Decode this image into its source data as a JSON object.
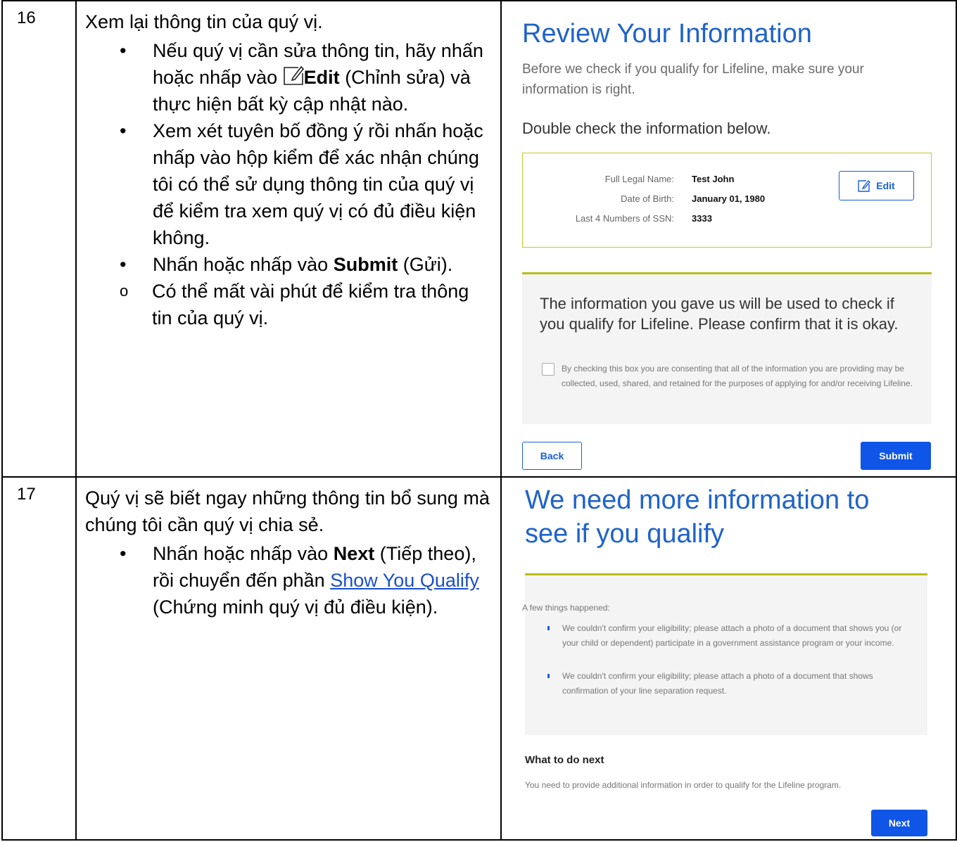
{
  "step16": {
    "number": "16",
    "intro": "Xem lại thông tin của quý vị.",
    "b1_pre": "Nếu quý vị cần sửa thông tin, hãy nhấn hoặc nhấp vào",
    "b1_bold": "Edit",
    "b1_post": "(Chỉnh sửa) và thực hiện bất kỳ cập nhật nào.",
    "b2": "Xem xét tuyên bố đồng ý rồi nhấn hoặc nhấp vào hộp kiểm để xác nhận chúng tôi có thể sử dụng thông tin của quý vị để kiểm tra xem quý vị có đủ điều kiện không.",
    "b3_pre": "Nhấn hoặc nhấp vào",
    "b3_bold": "Submit",
    "b3_post": "(Gửi).",
    "sub1": "Có thể mất vài phút để kiểm tra thông tin của quý vị."
  },
  "step17": {
    "number": "17",
    "intro": "Quý vị sẽ biết ngay những thông tin bổ sung mà chúng tôi cần quý vị chia sẻ.",
    "b1_pre": "Nhấn hoặc nhấp vào",
    "b1_bold": "Next",
    "b1_mid": "(Tiếp theo), rồi chuyển đến phần",
    "b1_link": "Show You Qualify",
    "b1_post": "(Chứng minh quý vị đủ điều kiện)."
  },
  "review": {
    "title": "Review Your Information",
    "lead": "Before we check if you qualify for Lifeline, make sure your information is right.",
    "subtitle": "Double check the information below.",
    "fields": [
      {
        "label": "Full Legal Name:",
        "value": "Test John"
      },
      {
        "label": "Date of Birth:",
        "value": "January 01, 1980"
      },
      {
        "label": "Last 4 Numbers of SSN:",
        "value": "3333"
      }
    ],
    "edit_label": "Edit",
    "consent_heading": "The information you gave us will be used to check if you qualify for Lifeline. Please confirm that it is okay.",
    "consent_text": "By checking this box you are consenting that all of the information you are providing may be collected, used, shared, and retained for the purposes of applying for and/or receiving Lifeline.",
    "back_label": "Back",
    "submit_label": "Submit"
  },
  "moreinfo": {
    "title": "We need more information to see if you qualify",
    "intro": "A few things happened:",
    "items": [
      "We couldn't confirm your eligibility; please attach a photo of a document that shows you (or your child or dependent) participate in a government assistance program or your income.",
      "We couldn't confirm your eligibility; please attach a photo of a document that shows confirmation of your line separation request."
    ],
    "next_heading": "What to do next",
    "next_text": "You need to provide additional information in order to qualify for the Lifeline program.",
    "next_label": "Next"
  }
}
